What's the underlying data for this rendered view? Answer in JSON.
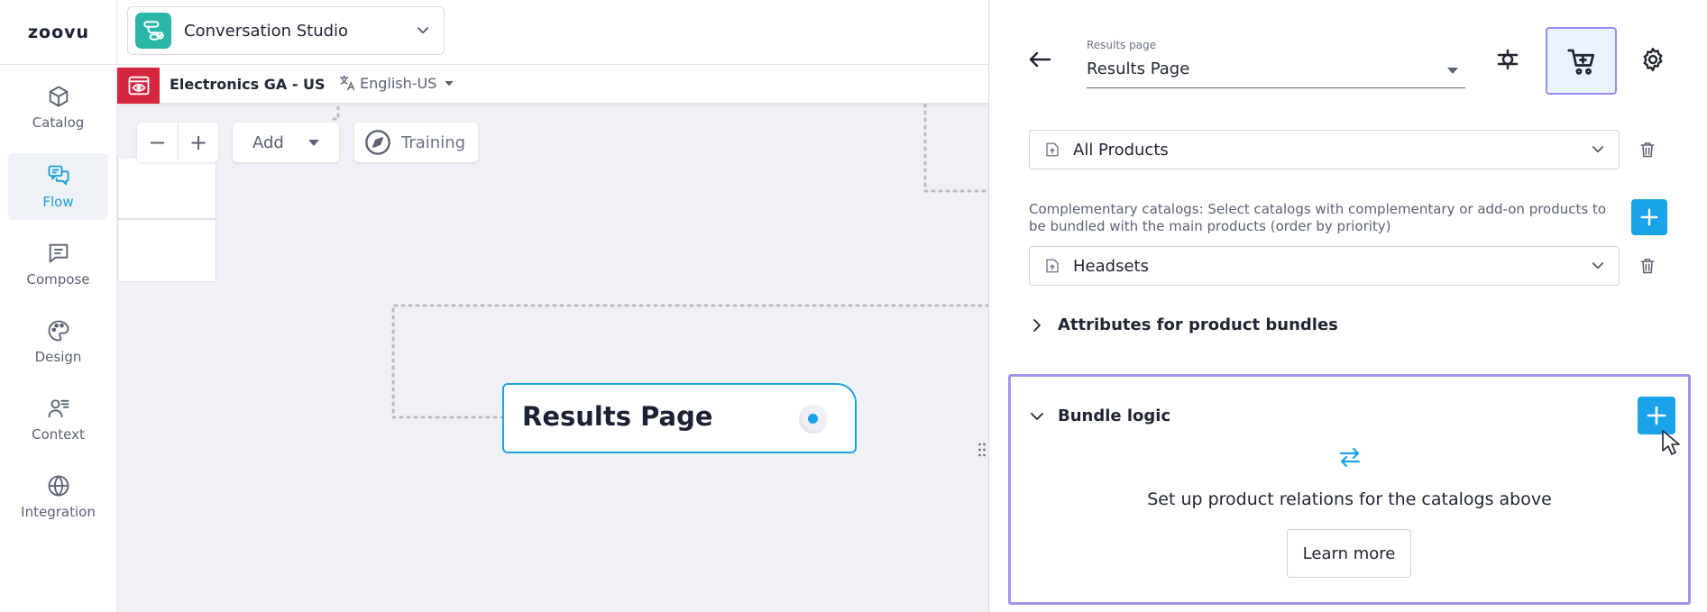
{
  "app": {
    "logo": "zoovu",
    "studio": "Conversation Studio",
    "project": "Electronics GA - US",
    "language": "English-US"
  },
  "nav": [
    {
      "label": "Catalog",
      "icon": "cube-icon",
      "active": false
    },
    {
      "label": "Flow",
      "icon": "chat-flow-icon",
      "active": true
    },
    {
      "label": "Compose",
      "icon": "message-icon",
      "active": false
    },
    {
      "label": "Design",
      "icon": "palette-icon",
      "active": false
    },
    {
      "label": "Context",
      "icon": "person-list-icon",
      "active": false
    },
    {
      "label": "Integration",
      "icon": "globe-icon",
      "active": false
    }
  ],
  "canvas": {
    "zoom_out": "−",
    "zoom_in": "+",
    "add_label": "Add",
    "training_label": "Training",
    "node_title": "Results Page"
  },
  "panel": {
    "results_page_label": "Results page",
    "results_page_value": "Results Page",
    "main_catalog": "All Products",
    "complementary_text": "Complementary catalogs: Select catalogs with complementary or add-on products to be bundled with the main products (order by priority)",
    "complementary_catalog": "Headsets",
    "attributes_label": "Attributes for product bundles",
    "bundle_logic_label": "Bundle logic",
    "bundle_empty_text": "Set up product relations for the catalogs above",
    "learn_more": "Learn more"
  },
  "colors": {
    "accent": "#1aa3e8",
    "highlight_border": "#a293ee",
    "studio_icon": "#2bb7a8",
    "project_badge": "#d6263f"
  }
}
